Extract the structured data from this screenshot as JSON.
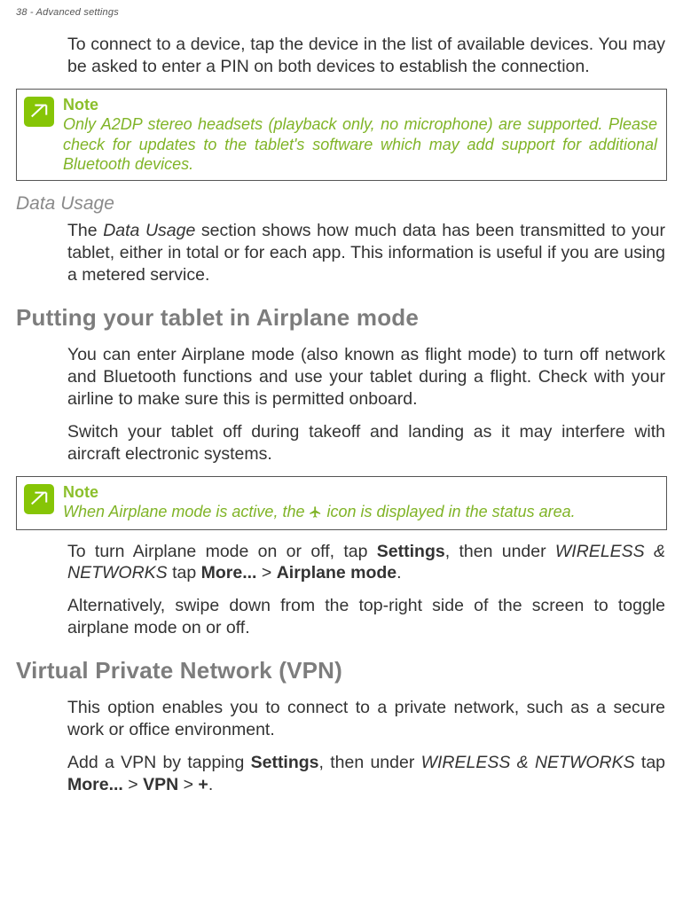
{
  "header": "38 - Advanced settings",
  "p1": "To connect to a device, tap the device in the list of available devices. You may be asked to enter a PIN on both devices to establish the connection.",
  "note1": {
    "title": "Note",
    "body": "Only A2DP stereo headsets (playback only, no microphone) are supported. Please check for updates to the tablet's software which may add support for additional Bluetooth devices."
  },
  "h3_data_usage": "Data Usage",
  "p2_a": "The ",
  "p2_i": "Data Usage",
  "p2_b": " section shows how much data has been transmitted to your tablet, either in total or for each app. This information is useful if you are using a metered service.",
  "h2_airplane": "Putting your tablet in Airplane mode",
  "p3": "You can enter Airplane mode (also known as flight mode) to turn off network and Bluetooth functions and use your tablet during a flight. Check with your airline to make sure this is permitted onboard.",
  "p4": "Switch your tablet off during takeoff and landing as it may interfere with aircraft electronic systems.",
  "note2": {
    "title": "Note",
    "body_a": "When Airplane mode is active, the ",
    "body_b": " icon is displayed in the status area."
  },
  "p5_a": "To turn Airplane mode on or off, tap ",
  "p5_b1": "Settings",
  "p5_c": ", then under ",
  "p5_i": "WIRELESS & NETWORKS",
  "p5_d": " tap ",
  "p5_b2": "More...",
  "p5_e": " > ",
  "p5_b3": "Airplane mode",
  "p5_f": ".",
  "p6": "Alternatively, swipe down from the top-right side of the screen to toggle airplane mode on or off.",
  "h2_vpn": "Virtual Private Network (VPN)",
  "p7": "This option enables you to connect to a private network, such as a secure work or office environment.",
  "p8_a": "Add a VPN by tapping ",
  "p8_b1": "Settings",
  "p8_c": ", then under ",
  "p8_i": "WIRELESS & NETWORKS",
  "p8_d": " tap ",
  "p8_b2": "More...",
  "p8_e": " > ",
  "p8_b3": "VPN",
  "p8_f": " > ",
  "p8_b4": "+",
  "p8_g": "."
}
